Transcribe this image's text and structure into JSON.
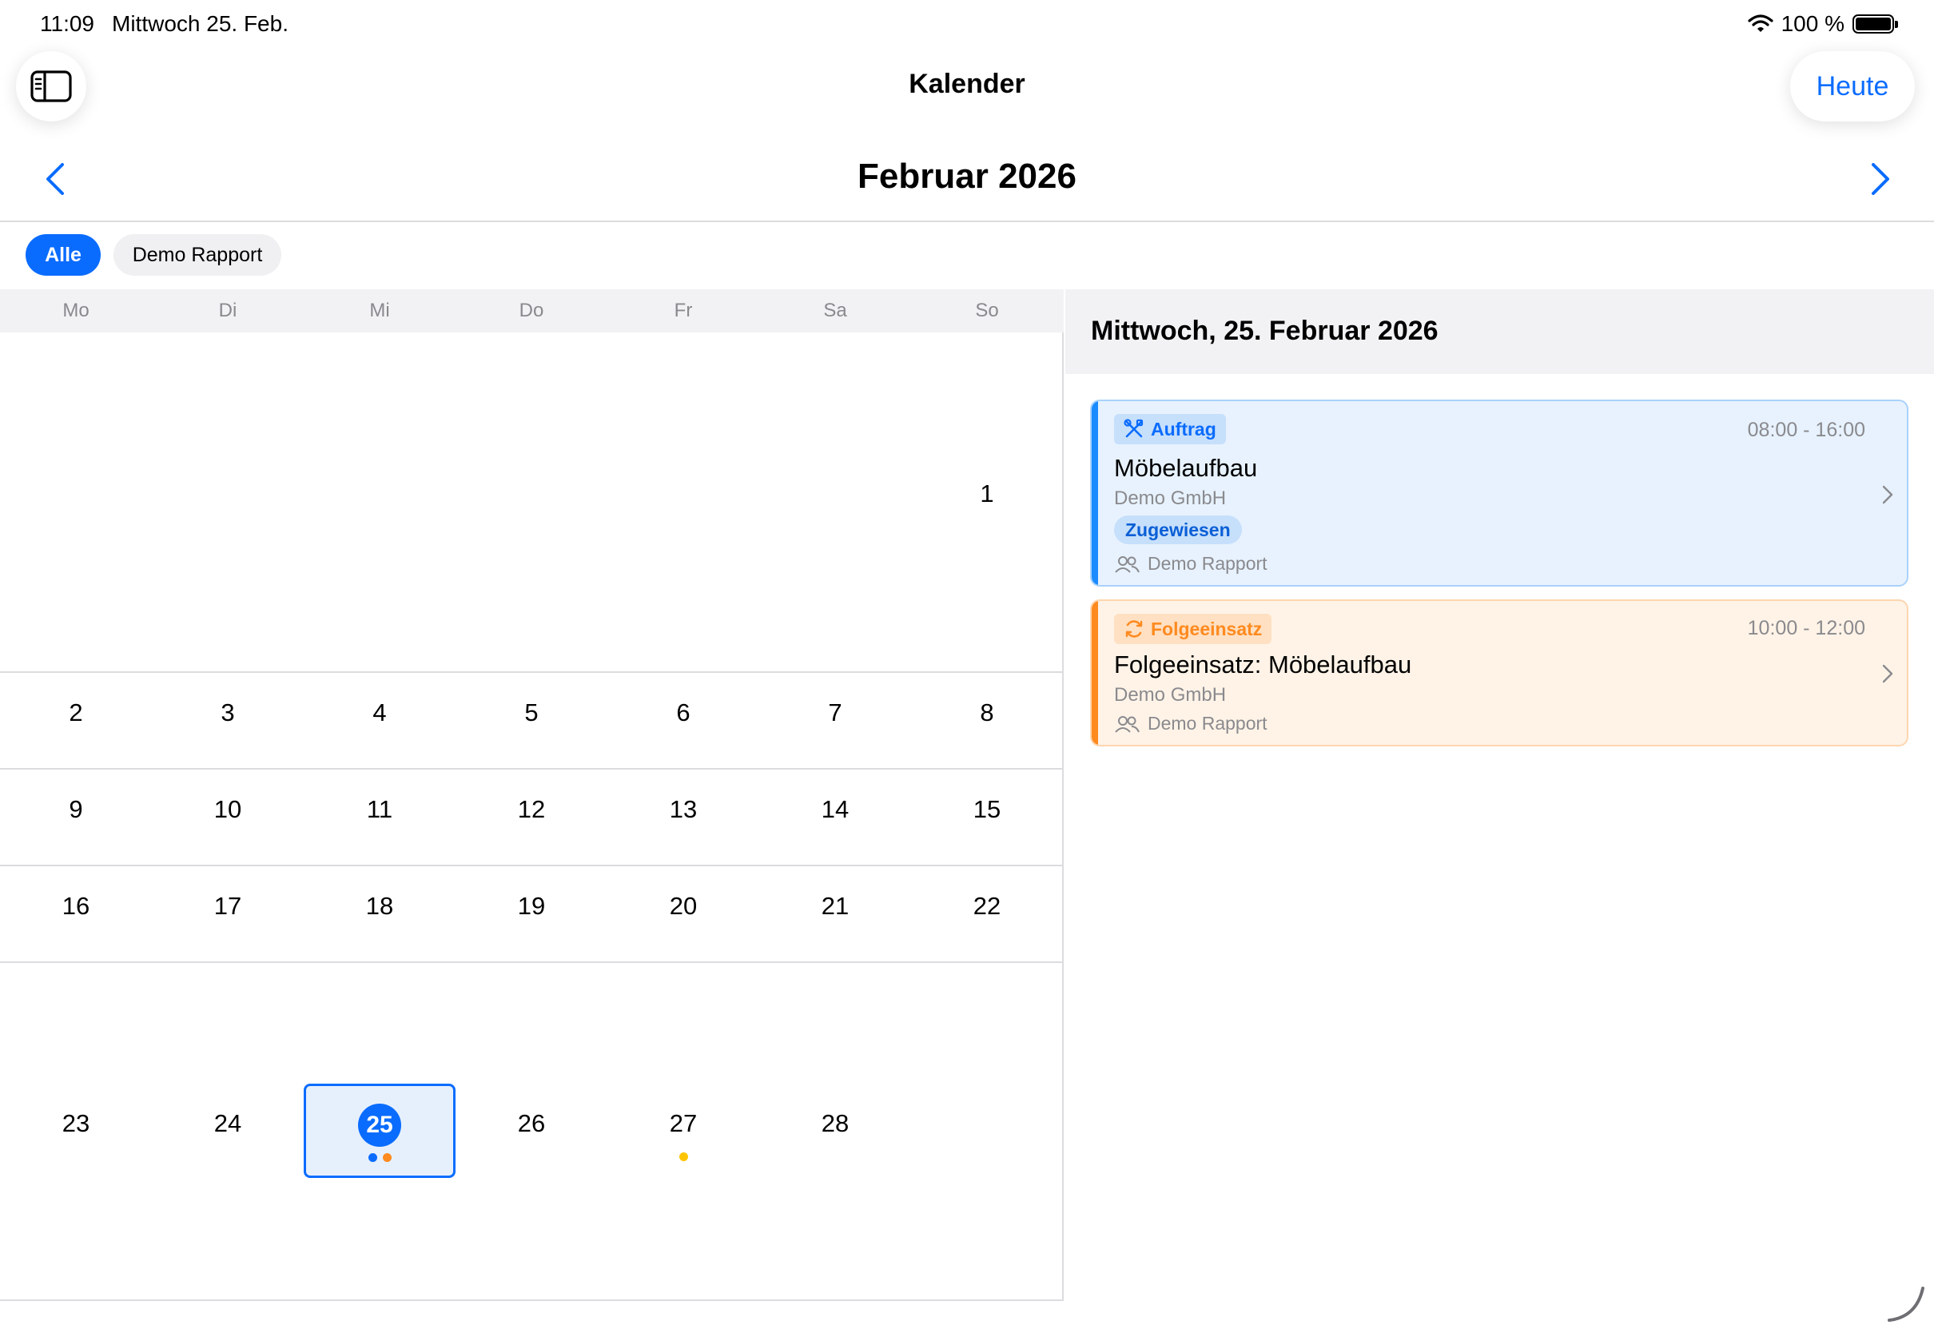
{
  "status_bar": {
    "time": "11:09",
    "date": "Mittwoch 25. Feb.",
    "battery": "100 %"
  },
  "nav": {
    "title": "Kalender",
    "today_label": "Heute"
  },
  "month": {
    "title": "Februar 2026"
  },
  "filters": [
    {
      "label": "Alle",
      "selected": true
    },
    {
      "label": "Demo Rapport",
      "selected": false
    }
  ],
  "weekdays": [
    "Mo",
    "Di",
    "Mi",
    "Do",
    "Fr",
    "Sa",
    "So"
  ],
  "weeks": [
    [
      "",
      "",
      "",
      "",
      "",
      "",
      "1"
    ],
    [
      "2",
      "3",
      "4",
      "5",
      "6",
      "7",
      "8"
    ],
    [
      "9",
      "10",
      "11",
      "12",
      "13",
      "14",
      "15"
    ],
    [
      "16",
      "17",
      "18",
      "19",
      "20",
      "21",
      "22"
    ],
    [
      "23",
      "24",
      "25",
      "26",
      "27",
      "28",
      ""
    ]
  ],
  "selected_day": "25",
  "event_dot_colors": {
    "auftrag": "#0a6cff",
    "folgeeinsatz": "#ff8a1f",
    "other": "#ffc400"
  },
  "day_panel": {
    "header": "Mittwoch, 25. Februar 2026",
    "events": [
      {
        "type": "Auftrag",
        "time": "08:00 - 16:00",
        "title": "Möbelaufbau",
        "customer": "Demo GmbH",
        "status": "Zugewiesen",
        "team": "Demo Rapport",
        "accent": "#1a8cff"
      },
      {
        "type": "Folgeeinsatz",
        "time": "10:00 - 12:00",
        "title": "Folgeeinsatz: Möbelaufbau",
        "customer": "Demo GmbH",
        "team": "Demo Rapport",
        "accent": "#ff8a1f"
      }
    ]
  }
}
